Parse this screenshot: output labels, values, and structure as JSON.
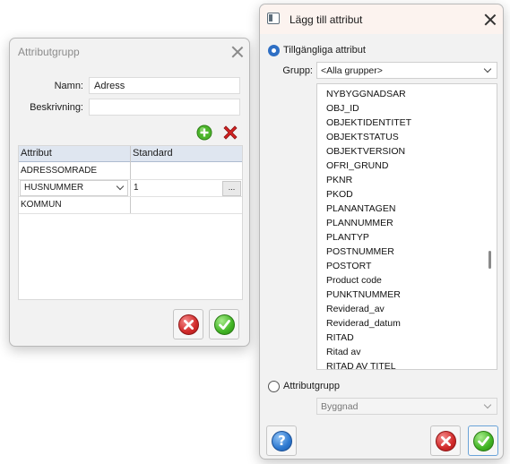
{
  "attr_group_dialog": {
    "title": "Attributgrupp",
    "name_label": "Namn:",
    "name_value": "Adress",
    "description_label": "Beskrivning:",
    "description_value": "",
    "columns": [
      "Attribut",
      "Standard"
    ],
    "rows": [
      {
        "attribut": "ADRESSOMRADE",
        "standard": ""
      },
      {
        "attribut": "HUSNUMMER",
        "standard": "1"
      },
      {
        "attribut": "KOMMUN",
        "standard": ""
      }
    ],
    "ellipsis_label": "...",
    "icons": {
      "add": "add-icon",
      "delete": "delete-icon",
      "cancel": "cancel-icon",
      "ok": "ok-icon"
    }
  },
  "add_attr_dialog": {
    "title": "Lägg till attribut",
    "available_label": "Tillgängliga attribut",
    "group_label": "Grupp:",
    "group_value": "<Alla grupper>",
    "attributes": [
      "NYBYGGNADSAR",
      "OBJ_ID",
      "OBJEKTIDENTITET",
      "OBJEKTSTATUS",
      "OBJEKTVERSION",
      "OFRI_GRUND",
      "PKNR",
      "PKOD",
      "PLANANTAGEN",
      "PLANNUMMER",
      "PLANTYP",
      "POSTNUMMER",
      "POSTORT",
      "Product code",
      "PUNKTNUMMER",
      "Reviderad_av",
      "Reviderad_datum",
      "RITAD",
      "Ritad av",
      "RITAD AV TITEL"
    ],
    "attrgroup_label": "Attributgrupp",
    "attrgroup_value": "Byggnad",
    "icons": {
      "app": "window-icon",
      "help": "help-icon",
      "cancel": "cancel-icon",
      "ok": "ok-icon"
    }
  },
  "colors": {
    "accent": "#2e6fc4",
    "grid_header": "#dfe6f0",
    "dialog_bg": "#f2f2f2",
    "titlebar_active": "#fcf3ef"
  }
}
